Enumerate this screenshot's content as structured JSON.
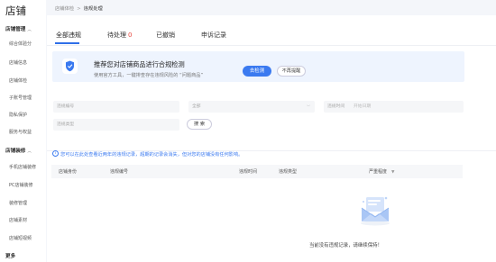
{
  "sidebar": {
    "title": "店铺",
    "sections": [
      {
        "label": "店铺管理",
        "items": [
          "综合体验分",
          "店铺信息",
          "店铺体检",
          "子账号管理",
          "隐私保护",
          "服务与权益"
        ]
      },
      {
        "label": "店铺装修",
        "items": [
          "手机店铺装修",
          "PC店铺装修",
          "装修管理",
          "店铺素材",
          "店铺短视频"
        ]
      },
      {
        "label": "更多",
        "items": []
      }
    ]
  },
  "breadcrumb": {
    "parent": "店铺体检",
    "separator": ">",
    "current": "违规处理"
  },
  "tabs": [
    {
      "label": "全部违规",
      "count": "",
      "active": true
    },
    {
      "label": "待处理",
      "count": "0",
      "active": false
    },
    {
      "label": "已撤销",
      "count": "",
      "active": false
    },
    {
      "label": "申诉记录",
      "count": "",
      "active": false
    }
  ],
  "banner": {
    "title": "推荐您对店铺商品进行合规检测",
    "desc": "使用官方工具，一键排查存在违规风险的 “问题商品”",
    "primary_button": "去检测",
    "secondary_button": "不再提醒",
    "icon": "shield-check-icon"
  },
  "filters": {
    "violation_id_placeholder": "违规编号",
    "type_placeholder": "全部",
    "time_label": "违规时间",
    "start_date_placeholder": "开始日期",
    "violation_type_placeholder": "违规类型",
    "search_button": "搜 索"
  },
  "notice": {
    "icon": "info-icon",
    "text": "您可以在此处查看近两年的违规记录，超期的记录会消失，但对您的店铺没有任何影响。"
  },
  "table": {
    "columns": [
      "店铺身份",
      "违规编号",
      "违规时间",
      "违规类型",
      "严重程度"
    ],
    "sort_icon": "filter-icon"
  },
  "empty_state": {
    "illustration": "empty-envelope-icon",
    "text": "当前没有违规记录，请继续保持！"
  },
  "colors": {
    "accent": "#3b7af0",
    "alert": "#e8453c",
    "banner_bg": "#eef4fe"
  }
}
